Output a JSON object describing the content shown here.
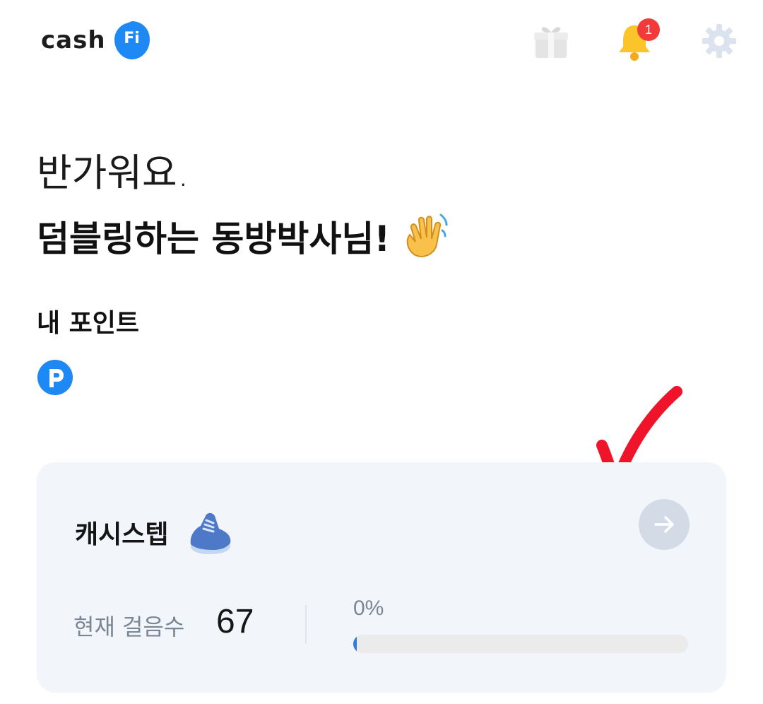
{
  "header": {
    "logo_text": "cash",
    "logo_badge": "Fi",
    "icons": [
      "gift-icon",
      "bell-icon",
      "gear-icon"
    ],
    "notification_count": "1"
  },
  "greeting": {
    "line1": "반가워요.",
    "line2": "덤블링하는 동방박사님!",
    "emoji_icon": "waving-hand-icon"
  },
  "points": {
    "title": "내 포인트",
    "icon": "point-icon",
    "value": ""
  },
  "card": {
    "title": "캐시스텝",
    "title_icon": "shoe-icon",
    "steps_label": "현재 걸음수",
    "steps_value": "67",
    "progress_text": "0%",
    "progress_fraction": 0.0
  },
  "colors": {
    "brand_blue": "#1e88f5",
    "bell_yellow": "#fbc42b",
    "badge_red": "#f23a3a",
    "card_bg": "#f2f6fb",
    "check_red": "#f0142a"
  }
}
